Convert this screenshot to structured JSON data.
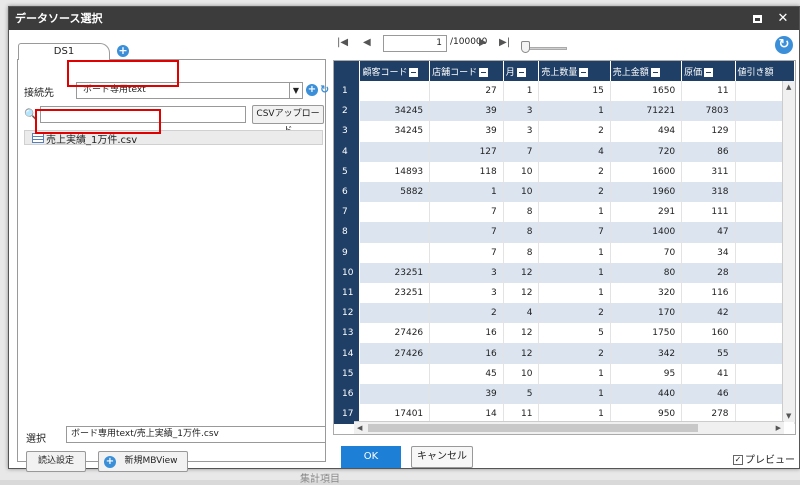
{
  "window": {
    "title": "データソース選択"
  },
  "background": {
    "bottom_text": "集計項目"
  },
  "left": {
    "tab_label": "DS1",
    "connection_label": "接続先",
    "connection_value": "ボード専用text",
    "csv_upload_label": "CSVアップロード",
    "file_name": "売上実績_1万件.csv",
    "selection_label": "選択",
    "selection_value": "ボード専用text/売上実績_1万件.csv",
    "read_settings_label": "読込設定",
    "new_mbview_label": "新規MBView"
  },
  "pager": {
    "current_page": "1",
    "total_pages": "/100000"
  },
  "grid": {
    "columns": [
      "",
      "顧客コード",
      "店舗コード",
      "月",
      "売上数量",
      "売上金額",
      "原価",
      "値引き額"
    ],
    "rows": [
      [
        "1",
        "",
        "27",
        "1",
        "15",
        "1650",
        "11",
        ""
      ],
      [
        "2",
        "34245",
        "39",
        "3",
        "1",
        "71221",
        "7803",
        ""
      ],
      [
        "3",
        "34245",
        "39",
        "3",
        "2",
        "494",
        "129",
        ""
      ],
      [
        "4",
        "",
        "127",
        "7",
        "4",
        "720",
        "86",
        ""
      ],
      [
        "5",
        "14893",
        "118",
        "10",
        "2",
        "1600",
        "311",
        ""
      ],
      [
        "6",
        "5882",
        "1",
        "10",
        "2",
        "1960",
        "318",
        ""
      ],
      [
        "7",
        "",
        "7",
        "8",
        "1",
        "291",
        "111",
        ""
      ],
      [
        "8",
        "",
        "7",
        "8",
        "7",
        "1400",
        "47",
        ""
      ],
      [
        "9",
        "",
        "7",
        "8",
        "1",
        "70",
        "34",
        ""
      ],
      [
        "10",
        "23251",
        "3",
        "12",
        "1",
        "80",
        "28",
        ""
      ],
      [
        "11",
        "23251",
        "3",
        "12",
        "1",
        "320",
        "116",
        ""
      ],
      [
        "12",
        "",
        "2",
        "4",
        "2",
        "170",
        "42",
        ""
      ],
      [
        "13",
        "27426",
        "16",
        "12",
        "5",
        "1750",
        "160",
        ""
      ],
      [
        "14",
        "27426",
        "16",
        "12",
        "2",
        "342",
        "55",
        ""
      ],
      [
        "15",
        "",
        "45",
        "10",
        "1",
        "95",
        "41",
        ""
      ],
      [
        "16",
        "",
        "39",
        "5",
        "1",
        "440",
        "46",
        ""
      ],
      [
        "17",
        "17401",
        "14",
        "11",
        "1",
        "950",
        "278",
        ""
      ]
    ]
  },
  "footer": {
    "ok_label": "OK",
    "cancel_label": "キャンセル",
    "preview_label": "プレビュー",
    "preview_checked": true
  }
}
